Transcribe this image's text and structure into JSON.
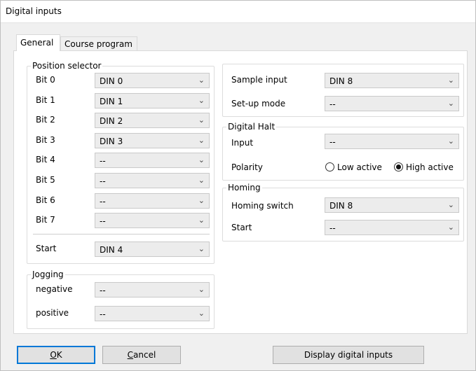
{
  "window": {
    "title": "Digital inputs"
  },
  "tabs": [
    {
      "label": "General",
      "active": true
    },
    {
      "label": "Course program",
      "active": false
    }
  ],
  "position_selector": {
    "title": "Position selector",
    "rows": [
      {
        "label": "Bit 0",
        "value": "DIN 0"
      },
      {
        "label": "Bit 1",
        "value": "DIN 1"
      },
      {
        "label": "Bit 2",
        "value": "DIN 2"
      },
      {
        "label": "Bit 3",
        "value": "DIN 3"
      },
      {
        "label": "Bit 4",
        "value": "--"
      },
      {
        "label": "Bit 5",
        "value": "--"
      },
      {
        "label": "Bit 6",
        "value": "--"
      },
      {
        "label": "Bit 7",
        "value": "--"
      }
    ],
    "start": {
      "label": "Start",
      "value": "DIN 4"
    }
  },
  "jogging": {
    "title": "Jogging",
    "negative": {
      "label": "negative",
      "value": "--"
    },
    "positive": {
      "label": "positive",
      "value": "--"
    }
  },
  "sample": {
    "sample_input": {
      "label": "Sample input",
      "value": "DIN 8"
    },
    "setup_mode": {
      "label": "Set-up mode",
      "value": "--"
    }
  },
  "digital_halt": {
    "title": "Digital Halt",
    "input": {
      "label": "Input",
      "value": "--"
    },
    "polarity": {
      "label": "Polarity",
      "low": "Low active",
      "high": "High active",
      "selected": "high"
    }
  },
  "homing": {
    "title": "Homing",
    "switch": {
      "label": "Homing switch",
      "value": "DIN 8"
    },
    "start": {
      "label": "Start",
      "value": "--"
    }
  },
  "buttons": {
    "ok_prefix": "",
    "ok_mnemonic": "O",
    "ok_rest": "K",
    "cancel_mnemonic": "C",
    "cancel_rest": "ancel",
    "display": "Display digital inputs"
  },
  "icons": {
    "dropdown": "chevron-down-icon"
  }
}
